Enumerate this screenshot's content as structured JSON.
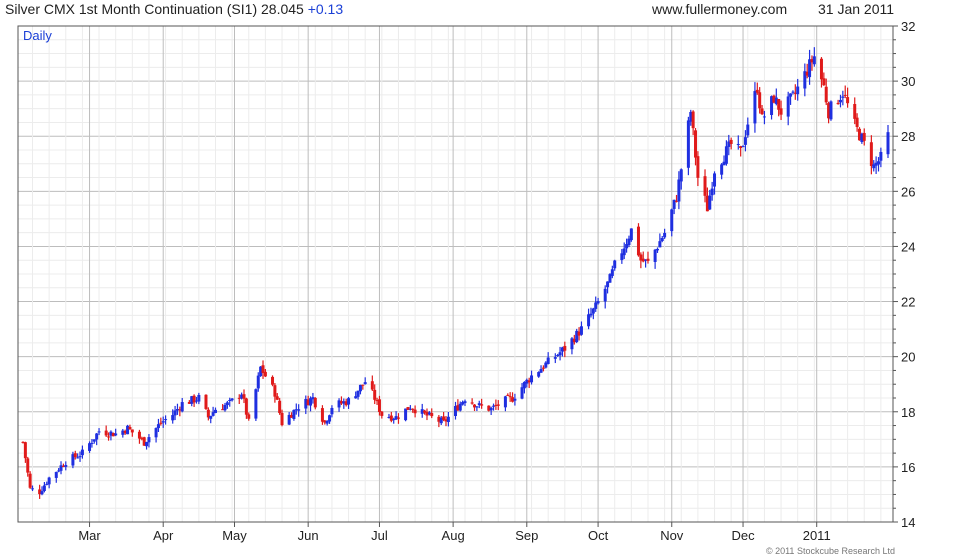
{
  "header": {
    "title": "Silver CMX 1st Month Continuation (SI1) 28.045",
    "change": "+0.13",
    "site": "www.fullermoney.com",
    "date": "31 Jan 2011"
  },
  "footer": {
    "copyright": "© 2011 Stockcube Research Ltd"
  },
  "colors": {
    "up": "#1f2fe0",
    "down": "#e01a1a",
    "grid": "#d9d9d9",
    "grid_major": "#bdbdbd",
    "period": "#1a3fd6"
  },
  "chart_data": {
    "type": "ohlc",
    "period_label": "Daily",
    "x_range": [
      "2010-02-01",
      "2011-01-31"
    ],
    "ylim": [
      14,
      32
    ],
    "y_ticks": [
      14,
      16,
      18,
      20,
      22,
      24,
      26,
      28,
      30,
      32
    ],
    "x_ticks": [
      {
        "date": "2010-03-01",
        "label": "Mar"
      },
      {
        "date": "2010-04-01",
        "label": "Apr"
      },
      {
        "date": "2010-05-01",
        "label": "May"
      },
      {
        "date": "2010-06-01",
        "label": "Jun"
      },
      {
        "date": "2010-07-01",
        "label": "Jul"
      },
      {
        "date": "2010-08-01",
        "label": "Aug"
      },
      {
        "date": "2010-09-01",
        "label": "Sep"
      },
      {
        "date": "2010-10-01",
        "label": "Oct"
      },
      {
        "date": "2010-11-01",
        "label": "Nov"
      },
      {
        "date": "2010-12-01",
        "label": "Dec"
      },
      {
        "date": "2011-01-01",
        "label": "2011"
      }
    ],
    "grid": true,
    "close_anchors": [
      [
        "2010-02-01",
        16.9
      ],
      [
        "2010-02-04",
        15.2
      ],
      [
        "2010-02-08",
        15.1
      ],
      [
        "2010-02-12",
        15.6
      ],
      [
        "2010-02-19",
        16.2
      ],
      [
        "2010-02-26",
        16.5
      ],
      [
        "2010-03-05",
        17.3
      ],
      [
        "2010-03-12",
        17.2
      ],
      [
        "2010-03-17",
        17.4
      ],
      [
        "2010-03-24",
        16.9
      ],
      [
        "2010-03-31",
        17.6
      ],
      [
        "2010-04-05",
        17.9
      ],
      [
        "2010-04-09",
        18.3
      ],
      [
        "2010-04-16",
        18.5
      ],
      [
        "2010-04-20",
        17.8
      ],
      [
        "2010-04-23",
        18.1
      ],
      [
        "2010-04-29",
        18.3
      ],
      [
        "2010-05-04",
        18.7
      ],
      [
        "2010-05-07",
        17.6
      ],
      [
        "2010-05-12",
        19.6
      ],
      [
        "2010-05-14",
        19.3
      ],
      [
        "2010-05-18",
        18.7
      ],
      [
        "2010-05-21",
        17.6
      ],
      [
        "2010-05-28",
        18.2
      ],
      [
        "2010-06-03",
        18.5
      ],
      [
        "2010-06-08",
        17.6
      ],
      [
        "2010-06-11",
        18.2
      ],
      [
        "2010-06-18",
        18.4
      ],
      [
        "2010-06-25",
        19.1
      ],
      [
        "2010-06-29",
        18.5
      ],
      [
        "2010-07-02",
        17.9
      ],
      [
        "2010-07-08",
        17.8
      ],
      [
        "2010-07-14",
        18.2
      ],
      [
        "2010-07-20",
        17.9
      ],
      [
        "2010-07-28",
        17.6
      ],
      [
        "2010-08-03",
        18.2
      ],
      [
        "2010-08-06",
        18.5
      ],
      [
        "2010-08-12",
        18.2
      ],
      [
        "2010-08-17",
        18.1
      ],
      [
        "2010-08-23",
        18.4
      ],
      [
        "2010-08-26",
        18.5
      ],
      [
        "2010-08-30",
        18.9
      ],
      [
        "2010-09-03",
        19.3
      ],
      [
        "2010-09-10",
        19.8
      ],
      [
        "2010-09-17",
        20.3
      ],
      [
        "2010-09-24",
        21.0
      ],
      [
        "2010-09-30",
        21.8
      ],
      [
        "2010-10-06",
        22.8
      ],
      [
        "2010-10-08",
        23.3
      ],
      [
        "2010-10-13",
        24.2
      ],
      [
        "2010-10-15",
        24.6
      ],
      [
        "2010-10-19",
        23.5
      ],
      [
        "2010-10-22",
        23.4
      ],
      [
        "2010-10-29",
        24.5
      ],
      [
        "2010-11-03",
        25.8
      ],
      [
        "2010-11-09",
        28.9
      ],
      [
        "2010-11-12",
        26.5
      ],
      [
        "2010-11-16",
        25.4
      ],
      [
        "2010-11-19",
        26.8
      ],
      [
        "2010-11-26",
        27.7
      ],
      [
        "2010-11-30",
        27.4
      ],
      [
        "2010-12-03",
        28.5
      ],
      [
        "2010-12-07",
        29.8
      ],
      [
        "2010-12-09",
        28.6
      ],
      [
        "2010-12-14",
        29.4
      ],
      [
        "2010-12-17",
        28.9
      ],
      [
        "2010-12-22",
        29.4
      ],
      [
        "2010-12-28",
        30.4
      ],
      [
        "2010-12-31",
        30.9
      ],
      [
        "2011-01-04",
        29.8
      ],
      [
        "2011-01-06",
        28.9
      ],
      [
        "2011-01-12",
        29.6
      ],
      [
        "2011-01-17",
        28.4
      ],
      [
        "2011-01-20",
        27.9
      ],
      [
        "2011-01-25",
        26.9
      ],
      [
        "2011-01-28",
        27.2
      ],
      [
        "2011-01-31",
        28.0
      ]
    ]
  }
}
